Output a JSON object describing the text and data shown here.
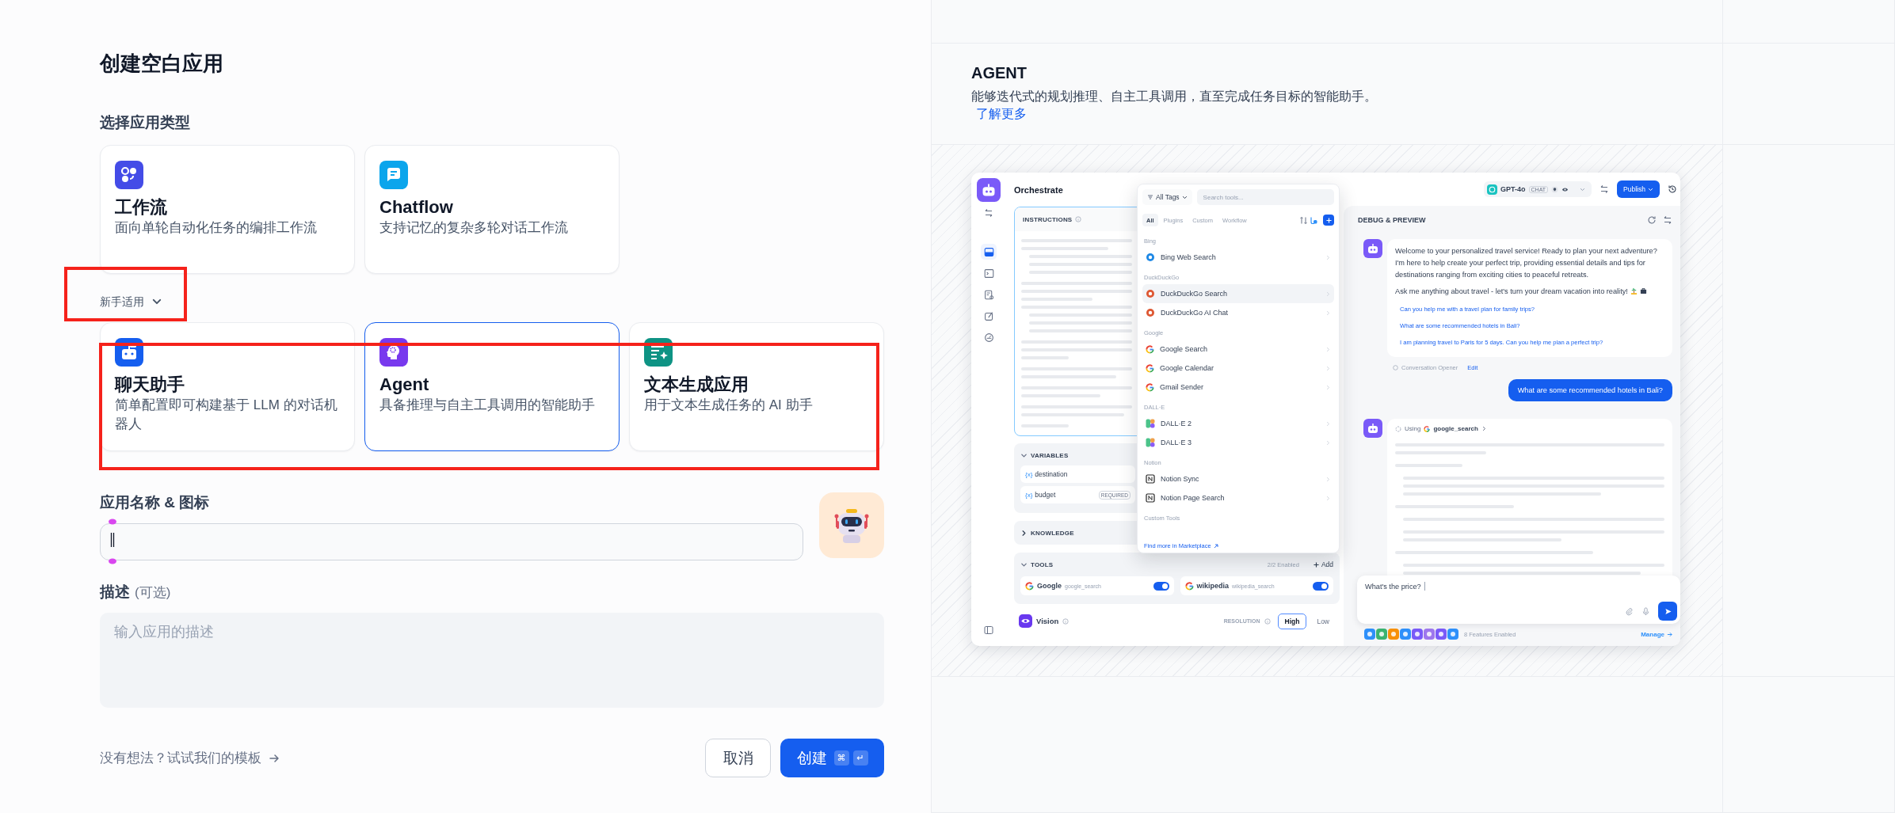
{
  "create": {
    "title": "创建空白应用",
    "type_label": "选择应用类型",
    "app_types": [
      {
        "name": "工作流",
        "description": "面向单轮自动化任务的编排工作流",
        "selected": false
      },
      {
        "name": "Chatflow",
        "description": "支持记忆的复杂多轮对话工作流",
        "selected": false
      }
    ],
    "beginner_toggle": {
      "label": "新手适用",
      "expanded": true
    },
    "beginner_types": [
      {
        "name": "聊天助手",
        "description": "简单配置即可构建基于 LLM 的对话机器人",
        "selected": false
      },
      {
        "name": "Agent",
        "description": "具备推理与自主工具调用的智能助手",
        "selected": true
      },
      {
        "name": "文本生成应用",
        "description": "用于文本生成任务的 AI 助手",
        "selected": false
      }
    ],
    "name_label": "应用名称 & 图标",
    "description_label": "描述",
    "description_optional": "(可选)",
    "description_placeholder": "输入应用的描述",
    "template_link": "没有想法？试试我们的模板",
    "cancel_button": "取消",
    "create_button": "创建",
    "shortcut_keys": [
      "⌘",
      "↵"
    ]
  },
  "preview": {
    "title": "AGENT",
    "description": "能够迭代式的规划推理、自主工具调用，直至完成任务目标的智能助手。",
    "learn_more": "了解更多",
    "app": {
      "nav_items": [
        {
          "selected": true
        },
        {
          "selected": false
        },
        {
          "selected": false
        },
        {
          "selected": false
        },
        {
          "selected": false
        }
      ],
      "title": "Orchestrate",
      "instructions_label": "INSTRUCTIONS",
      "variables": {
        "label": "VARIABLES",
        "expanded": true,
        "items": [
          {
            "prefix": "{x}",
            "name": "destination"
          },
          {
            "prefix": "{x}",
            "name": "budget",
            "badge": "REQUIRED"
          }
        ]
      },
      "knowledge": {
        "label": "KNOWLEDGE",
        "expanded": false
      },
      "tools": {
        "label": "TOOLS",
        "expanded": true,
        "count": "2/2 Enabled",
        "add": "Add",
        "items": [
          {
            "name": "Google",
            "id": "google_search",
            "on": true
          },
          {
            "name": "wikipedia",
            "id": "wikipedia_search",
            "on": true
          }
        ]
      },
      "vision": {
        "label": "Vision",
        "resolution_label": "RESOLUTION",
        "options": [
          {
            "label": "High",
            "selected": true
          },
          {
            "label": "Low",
            "selected": false
          }
        ]
      },
      "tool_picker": {
        "filter": "All Tags",
        "search_placeholder": "Search tools...",
        "tabs": [
          {
            "label": "All",
            "selected": true
          },
          {
            "label": "Plugins",
            "selected": false
          },
          {
            "label": "Custom",
            "selected": false
          },
          {
            "label": "Workflow",
            "selected": false
          }
        ],
        "groups": [
          {
            "name": "Bing",
            "items": [
              {
                "name": "Bing Web Search",
                "selected": false
              }
            ]
          },
          {
            "name": "DuckDuckGo",
            "items": [
              {
                "name": "DuckDuckGo Search",
                "selected": true
              },
              {
                "name": "DuckDuckGo AI Chat",
                "selected": false
              }
            ]
          },
          {
            "name": "Google",
            "items": [
              {
                "name": "Google Search",
                "selected": false
              },
              {
                "name": "Google Calendar",
                "selected": false
              },
              {
                "name": "Gmail Sender",
                "selected": false
              }
            ]
          },
          {
            "name": "DALL·E",
            "items": [
              {
                "name": "DALL·E 2",
                "selected": false
              },
              {
                "name": "DALL·E 3",
                "selected": false
              }
            ]
          },
          {
            "name": "Notion",
            "items": [
              {
                "name": "Notion Sync",
                "selected": false
              },
              {
                "name": "Notion Page Search",
                "selected": false
              }
            ]
          },
          {
            "name": "Custom Tools"
          }
        ],
        "marketplace_link": "Find more in Marketplace"
      },
      "model": {
        "name": "GPT-4o",
        "mode": "CHAT"
      },
      "publish_button": "Publish",
      "debug_title": "DEBUG & PREVIEW",
      "opener": {
        "paragraphs": [
          "Welcome to your personalized travel service! Ready to plan your next adventure? I'm here to help create your perfect trip, providing essential details and tips for destinations ranging from exciting cities to peaceful retreats.",
          "Ask me anything about travel - let's turn your dream vacation into reality!"
        ],
        "suggestions": [
          "Can you help me with a travel plan for family trips?",
          "What are some recommended hotels in Bali?",
          "I am planning travel to Paris for 5 days. Can you help me plan a perfect trip?"
        ],
        "label": "Conversation Opener",
        "edit": "Edit"
      },
      "user_message": "What are some recommended hotels in Bali?",
      "tool_call": {
        "label": "Using",
        "tool": "google_search"
      },
      "input_value": "What's the price?",
      "features": {
        "icons": [
          {
            "color": "#2e90fa"
          },
          {
            "color": "#3cb371"
          },
          {
            "color": "#f79009"
          },
          {
            "color": "#2e90fa"
          },
          {
            "color": "#7a5af8"
          },
          {
            "color": "#9e77ed"
          },
          {
            "color": "#7a5af8"
          },
          {
            "color": "#2e90fa"
          }
        ],
        "label": "8 Features Enabled",
        "manage": "Manage"
      }
    }
  }
}
